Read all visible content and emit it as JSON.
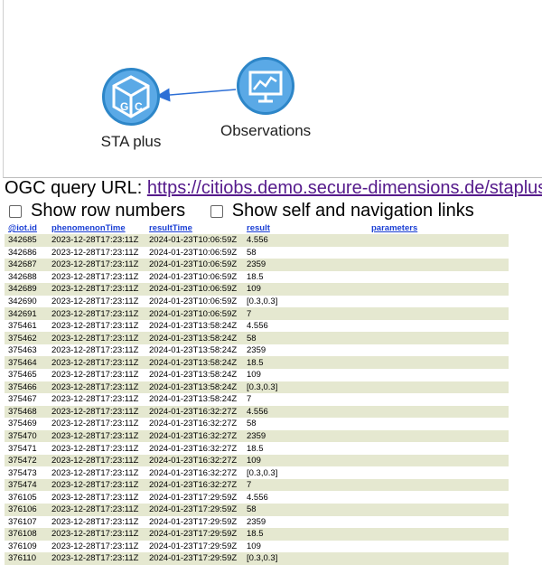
{
  "graph": {
    "nodes": [
      {
        "label": "STA plus",
        "icon": "ogc-cube-icon"
      },
      {
        "label": "Observations",
        "icon": "chart-monitor-icon"
      }
    ]
  },
  "query": {
    "label": "OGC query URL: ",
    "url": "https://citiobs.demo.secure-dimensions.de/staplus"
  },
  "options": {
    "row_numbers": "Show row numbers",
    "self_links": "Show self and navigation links"
  },
  "table": {
    "headers": [
      "@iot.id",
      "phenomenonTime",
      "resultTime",
      "result",
      "parameters"
    ],
    "rows": [
      [
        "342685",
        "2023-12-28T17:23:11Z",
        "2024-01-23T10:06:59Z",
        "4.556",
        ""
      ],
      [
        "342686",
        "2023-12-28T17:23:11Z",
        "2024-01-23T10:06:59Z",
        "58",
        ""
      ],
      [
        "342687",
        "2023-12-28T17:23:11Z",
        "2024-01-23T10:06:59Z",
        "2359",
        ""
      ],
      [
        "342688",
        "2023-12-28T17:23:11Z",
        "2024-01-23T10:06:59Z",
        "18.5",
        ""
      ],
      [
        "342689",
        "2023-12-28T17:23:11Z",
        "2024-01-23T10:06:59Z",
        "109",
        ""
      ],
      [
        "342690",
        "2023-12-28T17:23:11Z",
        "2024-01-23T10:06:59Z",
        "[0.3,0.3]",
        ""
      ],
      [
        "342691",
        "2023-12-28T17:23:11Z",
        "2024-01-23T10:06:59Z",
        "7",
        ""
      ],
      [
        "375461",
        "2023-12-28T17:23:11Z",
        "2024-01-23T13:58:24Z",
        "4.556",
        ""
      ],
      [
        "375462",
        "2023-12-28T17:23:11Z",
        "2024-01-23T13:58:24Z",
        "58",
        ""
      ],
      [
        "375463",
        "2023-12-28T17:23:11Z",
        "2024-01-23T13:58:24Z",
        "2359",
        ""
      ],
      [
        "375464",
        "2023-12-28T17:23:11Z",
        "2024-01-23T13:58:24Z",
        "18.5",
        ""
      ],
      [
        "375465",
        "2023-12-28T17:23:11Z",
        "2024-01-23T13:58:24Z",
        "109",
        ""
      ],
      [
        "375466",
        "2023-12-28T17:23:11Z",
        "2024-01-23T13:58:24Z",
        "[0.3,0.3]",
        ""
      ],
      [
        "375467",
        "2023-12-28T17:23:11Z",
        "2024-01-23T13:58:24Z",
        "7",
        ""
      ],
      [
        "375468",
        "2023-12-28T17:23:11Z",
        "2024-01-23T16:32:27Z",
        "4.556",
        ""
      ],
      [
        "375469",
        "2023-12-28T17:23:11Z",
        "2024-01-23T16:32:27Z",
        "58",
        ""
      ],
      [
        "375470",
        "2023-12-28T17:23:11Z",
        "2024-01-23T16:32:27Z",
        "2359",
        ""
      ],
      [
        "375471",
        "2023-12-28T17:23:11Z",
        "2024-01-23T16:32:27Z",
        "18.5",
        ""
      ],
      [
        "375472",
        "2023-12-28T17:23:11Z",
        "2024-01-23T16:32:27Z",
        "109",
        ""
      ],
      [
        "375473",
        "2023-12-28T17:23:11Z",
        "2024-01-23T16:32:27Z",
        "[0.3,0.3]",
        ""
      ],
      [
        "375474",
        "2023-12-28T17:23:11Z",
        "2024-01-23T16:32:27Z",
        "7",
        ""
      ],
      [
        "376105",
        "2023-12-28T17:23:11Z",
        "2024-01-23T17:29:59Z",
        "4.556",
        ""
      ],
      [
        "376106",
        "2023-12-28T17:23:11Z",
        "2024-01-23T17:29:59Z",
        "58",
        ""
      ],
      [
        "376107",
        "2023-12-28T17:23:11Z",
        "2024-01-23T17:29:59Z",
        "2359",
        ""
      ],
      [
        "376108",
        "2023-12-28T17:23:11Z",
        "2024-01-23T17:29:59Z",
        "18.5",
        ""
      ],
      [
        "376109",
        "2023-12-28T17:23:11Z",
        "2024-01-23T17:29:59Z",
        "109",
        ""
      ],
      [
        "376110",
        "2023-12-28T17:23:11Z",
        "2024-01-23T17:29:59Z",
        "[0.3,0.3]",
        ""
      ]
    ]
  },
  "colors": {
    "node_fill": "#5aa9e6",
    "node_border": "#2d86c8",
    "edge": "#2d6fd6",
    "link": "#551a8b",
    "header_link": "#1a3fd4",
    "row_stripe": "#e5e8d0"
  }
}
